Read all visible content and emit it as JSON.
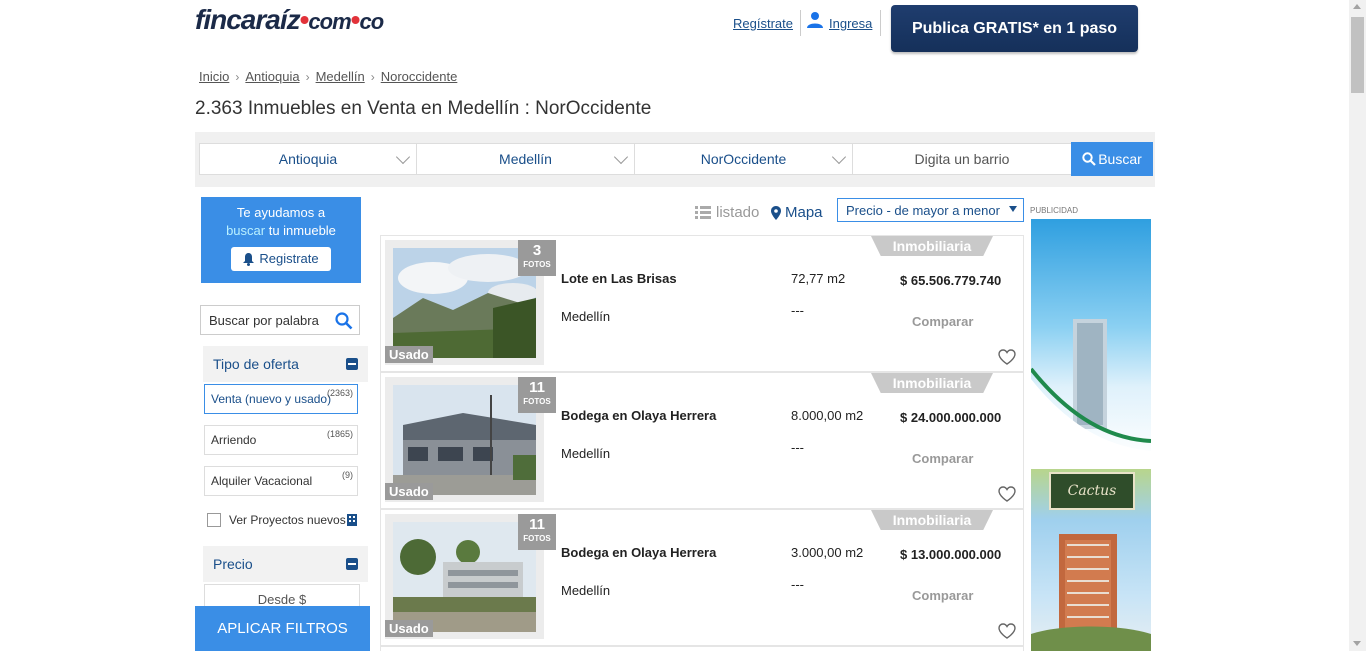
{
  "header": {
    "logo_main": "fincaraíz",
    "logo_com": "com",
    "logo_co": "co",
    "register_link": "Regístrate",
    "login_link": "Ingresa",
    "publish_button": "Publica GRATIS* en 1 paso"
  },
  "breadcrumb": [
    "Inicio",
    "Antioquia",
    "Medellín",
    "Noroccidente"
  ],
  "page_title": "2.363 Inmuebles en Venta en Medellín : NorOccidente",
  "search": {
    "department": "Antioquia",
    "city": "Medellín",
    "zone": "NorOccidente",
    "barrio_placeholder": "Digita un barrio",
    "search_button": "Buscar"
  },
  "sidebar": {
    "help_line1": "Te ayudamos a",
    "help_highlight": "buscar",
    "help_line2": " tu inmueble",
    "help_button": "Registrate",
    "keyword_placeholder": "Buscar por palabra",
    "offer_title": "Tipo de oferta",
    "offers": [
      {
        "label": "Venta (nuevo y usado)",
        "count": "(2363)"
      },
      {
        "label": "Arriendo",
        "count": "(1865)"
      },
      {
        "label": "Alquiler Vacacional",
        "count": "(9)"
      }
    ],
    "projects_label": "Ver Proyectos nuevos",
    "price_title": "Precio",
    "price_from": "Desde $",
    "apply_button": "APLICAR FILTROS"
  },
  "toolbar": {
    "list_view": "listado",
    "map_view": "Mapa",
    "sort_selected": "Precio - de mayor a menor"
  },
  "listings": [
    {
      "photos": "3",
      "photos_label": "FOTOS",
      "condition": "Usado",
      "badge": "Inmobiliaria",
      "title": "Lote en Las Brisas",
      "city": "Medellín",
      "area": "72,77 m2",
      "rooms": "---",
      "price": "$ 65.506.779.740",
      "compare": "Comparar"
    },
    {
      "photos": "11",
      "photos_label": "FOTOS",
      "condition": "Usado",
      "badge": "Inmobiliaria",
      "title": "Bodega en Olaya Herrera",
      "city": "Medellín",
      "area": "8.000,00 m2",
      "rooms": "---",
      "price": "$ 24.000.000.000",
      "compare": "Comparar"
    },
    {
      "photos": "11",
      "photos_label": "FOTOS",
      "condition": "Usado",
      "badge": "Inmobiliaria",
      "title": "Bodega en Olaya Herrera",
      "city": "Medellín",
      "area": "3.000,00 m2",
      "rooms": "---",
      "price": "$ 13.000.000.000",
      "compare": "Comparar"
    }
  ],
  "ads": {
    "label": "PUBLICIDAD",
    "ad2_brand": "Cactus"
  },
  "colors": {
    "brand_navy": "#1b2a48",
    "accent_blue": "#3a8ee6",
    "link_blue": "#1a4f8a",
    "logo_red": "#e2323a"
  }
}
